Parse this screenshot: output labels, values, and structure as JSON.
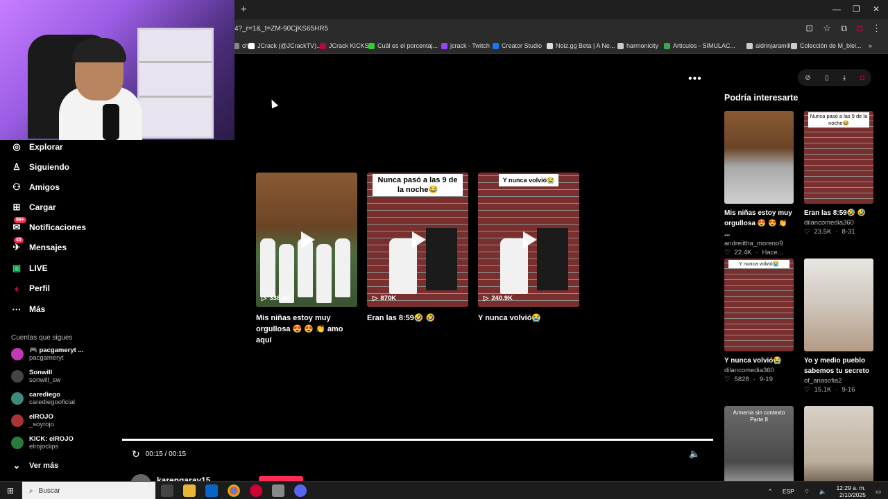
{
  "browser": {
    "url": "4?_r=1&_t=ZM-90CjKS65HR5",
    "new_tab": "+",
    "window_controls": [
      "—",
      "❐",
      "✕"
    ],
    "bookmarks": [
      {
        "label": "ch",
        "color": "#888"
      },
      {
        "label": "JCrack (@JCrackTV)...",
        "color": "#fff"
      },
      {
        "label": "JCrack KICKS",
        "color": "#b04"
      },
      {
        "label": "Cuál es el porcentaj...",
        "color": "#3c3"
      },
      {
        "label": "jcrack - Twitch",
        "color": "#9147ff"
      },
      {
        "label": "Creator Studio",
        "color": "#1877f2"
      },
      {
        "label": "Noiz.gg Beta | A Ne...",
        "color": "#ddd"
      },
      {
        "label": "harmonicity",
        "color": "#ccc"
      },
      {
        "label": "Articulos - SIMULAC...",
        "color": "#34a853"
      },
      {
        "label": "aldrinjaramillo",
        "color": "#ccc"
      },
      {
        "label": "Colección de M_blei...",
        "color": "#ccc"
      }
    ],
    "bookmarks_more": "»"
  },
  "sidebar": {
    "nav": [
      {
        "label": "Explorar",
        "icon": "compass-icon",
        "glyph": "◎"
      },
      {
        "label": "Siguiendo",
        "icon": "following-icon",
        "glyph": "♙"
      },
      {
        "label": "Amigos",
        "icon": "friends-icon",
        "glyph": "⚇"
      },
      {
        "label": "Cargar",
        "icon": "upload-icon",
        "glyph": "⊞"
      },
      {
        "label": "Notificaciones",
        "icon": "bell-icon",
        "glyph": "✉",
        "badge": "99+"
      },
      {
        "label": "Mensajes",
        "icon": "messages-icon",
        "glyph": "✈",
        "badge": "43"
      },
      {
        "label": "LIVE",
        "icon": "live-icon",
        "glyph": "▣"
      },
      {
        "label": "Perfil",
        "icon": "profile-icon",
        "glyph": "♦"
      },
      {
        "label": "Más",
        "icon": "more-icon",
        "glyph": "···"
      }
    ],
    "following_title": "Cuentas que sigues",
    "following": [
      {
        "name": "🎮 pacgameryt ...",
        "handle": "pacgameryt",
        "color": "#c239b3"
      },
      {
        "name": "Sonwill",
        "handle": "sonwill_sw",
        "color": "#444"
      },
      {
        "name": "carediego",
        "handle": "carediegooficial",
        "color": "#3a8d7a"
      },
      {
        "name": "elROJO",
        "handle": "_soyrojo",
        "color": "#a33"
      },
      {
        "name": "KICK: elROJO",
        "handle": "elrojoclips",
        "color": "#2a7a3a"
      }
    ],
    "see_more": "Ver más"
  },
  "main": {
    "videos": [
      {
        "title": "Mis niñas estoy muy orgullosa 😍 😍 👏 amo aquí",
        "views": "338.6K",
        "caption": "",
        "style": "wood"
      },
      {
        "title": "Eran las 8:59🤣 🤣",
        "views": "870K",
        "caption": "Nunca pasó a las 9 de la noche😂",
        "style": "brick"
      },
      {
        "title": "Y nunca volvió😭",
        "views": "240.9K",
        "caption": "Y nunca volvió😭",
        "style": "brick"
      }
    ],
    "time": "00:15 / 00:15",
    "bottom_user": "karengaray15"
  },
  "right_panel": {
    "title": "Podría interesarte",
    "cards": [
      {
        "title": "Mis niñas estoy muy orgullosa 😍 😍 👏 ...",
        "author": "andreiitha_moreno9",
        "likes": "22.4K",
        "date": "Hace...",
        "caption": "",
        "style": "wood"
      },
      {
        "title": "Eran las 8:59🤣 🤣",
        "author": "dilancomedia360",
        "likes": "23.5K",
        "date": "8-31",
        "caption": "Nunca pasó a las 9 de la noche😂",
        "style": "brick"
      },
      {
        "title": "Y nunca volvió😭",
        "author": "dilancomedia360",
        "likes": "5828",
        "date": "9-19",
        "caption": "Y nunca volvió😭",
        "style": "brick"
      },
      {
        "title": "Yo y medio pueblo sabemos tu secreto",
        "author": "of_anasofia2",
        "likes": "15.1K",
        "date": "9-16",
        "caption": "",
        "style": "face"
      },
      {
        "title": "",
        "author": "",
        "likes": "",
        "date": "",
        "caption": "Armenia sin contexto Parte 8",
        "style": "gray"
      },
      {
        "title": "",
        "author": "",
        "likes": "",
        "date": "",
        "caption": "",
        "style": "room"
      }
    ]
  },
  "taskbar": {
    "search_placeholder": "Buscar",
    "lang": "ESP",
    "time": "12:29 a. m.",
    "date": "2/10/2025"
  }
}
